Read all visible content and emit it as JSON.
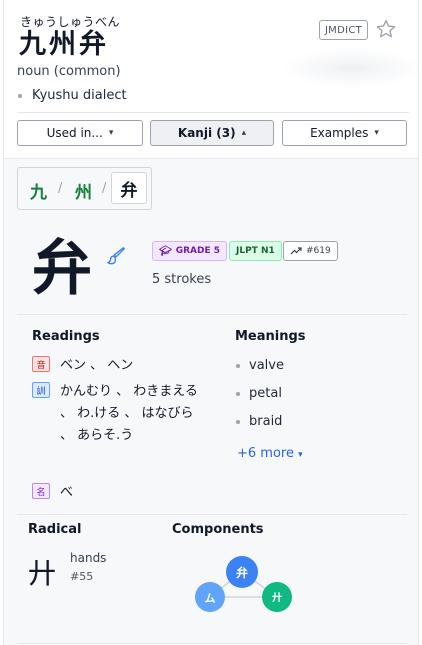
{
  "entry": {
    "reading": "きゅうしゅうべん",
    "word": "九州弁",
    "source_badge": "JMDICT",
    "part_of_speech": "noun (common)",
    "senses": [
      "Kyushu dialect"
    ]
  },
  "buttons": {
    "used_in": "Used in...",
    "kanji": "Kanji (3)",
    "examples": "Examples"
  },
  "kanji_tabs": [
    {
      "char": "九"
    },
    {
      "char": "州"
    },
    {
      "char": "弁",
      "selected": true
    }
  ],
  "kanji": {
    "char": "弁",
    "grade": "GRADE 5",
    "jlpt": "JLPT N1",
    "frequency": "#619",
    "strokes": "5 strokes"
  },
  "readings": {
    "title": "Readings",
    "on": {
      "label": "音",
      "text": "ベン 、 ヘン"
    },
    "kun": {
      "label": "訓",
      "text": "かんむり 、 わきまえる 、 わ.ける 、 はなびら 、 あらそ.う"
    },
    "nanori": {
      "label": "名",
      "text": "べ"
    }
  },
  "meanings": {
    "title": "Meanings",
    "items": [
      "valve",
      "petal",
      "braid"
    ],
    "more": "+6 more"
  },
  "radical": {
    "title": "Radical",
    "char": "廾",
    "name": "hands",
    "number": "#55"
  },
  "components": {
    "title": "Components",
    "nodes": [
      "弁",
      "ム",
      "廾"
    ]
  },
  "colors": {
    "on_reading": "#b91c1c",
    "kun_reading": "#1d4ed8",
    "nanori": "#7e22ce",
    "link": "#2563eb",
    "kanji_tab": "#15803d",
    "component_main": "#3b82f6",
    "component_left": "#60a5fa",
    "component_right": "#10b981"
  }
}
